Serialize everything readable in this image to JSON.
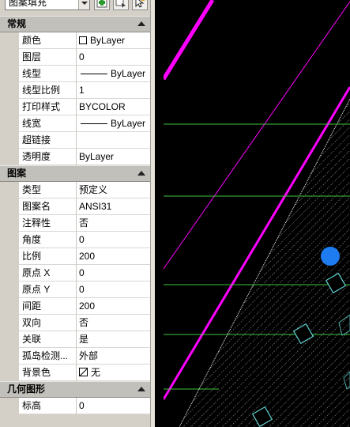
{
  "toolbar": {
    "selected_object": "图案填充",
    "icons": [
      "toggle-pickadd-icon",
      "quick-select-icon",
      "select-objects-icon"
    ]
  },
  "categories": [
    {
      "key": "general",
      "title": "常规",
      "rows": [
        {
          "label": "颜色",
          "value": "ByLayer",
          "widget": "color-swatch"
        },
        {
          "label": "图层",
          "value": "0"
        },
        {
          "label": "线型",
          "value": "ByLayer",
          "widget": "linetype"
        },
        {
          "label": "线型比例",
          "value": "1"
        },
        {
          "label": "打印样式",
          "value": "BYCOLOR"
        },
        {
          "label": "线宽",
          "value": "ByLayer",
          "widget": "linetype"
        },
        {
          "label": "超链接",
          "value": ""
        },
        {
          "label": "透明度",
          "value": "ByLayer"
        }
      ]
    },
    {
      "key": "pattern",
      "title": "图案",
      "rows": [
        {
          "label": "类型",
          "value": "预定义"
        },
        {
          "label": "图案名",
          "value": "ANSI31"
        },
        {
          "label": "注释性",
          "value": "否"
        },
        {
          "label": "角度",
          "value": "0"
        },
        {
          "label": "比例",
          "value": "200"
        },
        {
          "label": "原点 X",
          "value": "0"
        },
        {
          "label": "原点 Y",
          "value": "0"
        },
        {
          "label": "间距",
          "value": "200"
        },
        {
          "label": "双向",
          "value": "否"
        },
        {
          "label": "关联",
          "value": "是"
        },
        {
          "label": "孤岛检测...",
          "value": "外部"
        },
        {
          "label": "背景色",
          "value": "无",
          "widget": "bg-none"
        }
      ]
    },
    {
      "key": "geometry",
      "title": "几何图形",
      "rows": [
        {
          "label": "标高",
          "value": "0"
        }
      ]
    }
  ],
  "colors": {
    "palette_bg": "#d4d0c8",
    "header_bg": "#c2c0ba",
    "canvas_bg": "#000000",
    "magenta_line": "#ff00ff",
    "green_line": "#3cc43c",
    "white_hatch": "#ffffff",
    "cyan_block": "#5fd0d0",
    "grip_blue": "#1f7cf0"
  }
}
